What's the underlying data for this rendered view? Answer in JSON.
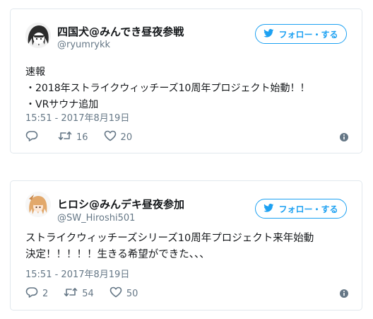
{
  "tweets": [
    {
      "display_name": "四国犬@みんでき昼夜参戦",
      "handle": "@ryumrykk",
      "follow_label": "フォロー・する",
      "lines": [
        "速報",
        "・2018年ストライクウィッチーズ10周年プロジェクト始動！！",
        "・VRサウナ追加"
      ],
      "timestamp": "15:51 - 2017年8月19日",
      "replies": "",
      "retweets": "16",
      "likes": "20"
    },
    {
      "display_name": "ヒロシ@みんデキ昼夜参加",
      "handle": "@SW_Hiroshi501",
      "follow_label": "フォロー・する",
      "lines": [
        "ストライクウィッチーズシリーズ10周年プロジェクト来年始動",
        "決定！！！！！生きる希望ができた、、、"
      ],
      "timestamp": "15:51 - 2017年8月19日",
      "replies": "2",
      "retweets": "54",
      "likes": "50"
    }
  ],
  "icons": {
    "follow": "twitter-bird-icon",
    "reply": "reply-icon",
    "retweet": "retweet-icon",
    "like": "heart-icon",
    "info": "info-icon"
  },
  "colors": {
    "accent": "#1da1f2",
    "secondary_text": "#657786",
    "border": "#e1e8ed"
  }
}
